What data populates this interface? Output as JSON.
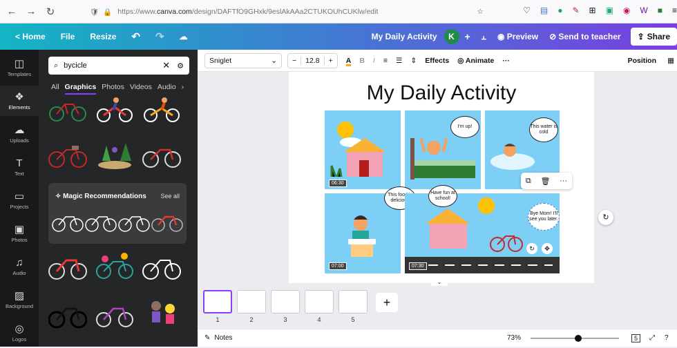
{
  "browser": {
    "url_prefix": "https://www.",
    "url_domain": "canva.com",
    "url_rest": "/design/DAFTfO9GHxk/9eslAkAAa2CTUKOUhCUKlw/edit"
  },
  "topbar": {
    "home": "< Home",
    "file": "File",
    "resize": "Resize",
    "title": "My Daily Activity",
    "avatar": "K",
    "preview": "Preview",
    "send": "Send to teacher",
    "share": "Share"
  },
  "rail": [
    {
      "icon": "templates-icon",
      "label": "Templates"
    },
    {
      "icon": "elements-icon",
      "label": "Elements"
    },
    {
      "icon": "uploads-icon",
      "label": "Uploads"
    },
    {
      "icon": "text-icon",
      "label": "Text"
    },
    {
      "icon": "projects-icon",
      "label": "Projects"
    },
    {
      "icon": "photos-icon",
      "label": "Photos"
    },
    {
      "icon": "audio-icon",
      "label": "Audio"
    },
    {
      "icon": "background-icon",
      "label": "Background"
    },
    {
      "icon": "logos-icon",
      "label": "Logos"
    }
  ],
  "search": {
    "value": "bycicle"
  },
  "tabs": [
    "All",
    "Graphics",
    "Photos",
    "Videos",
    "Audio"
  ],
  "magic": {
    "title": "Magic Recommendations",
    "see_all": "See all"
  },
  "toolbar": {
    "font": "Sniglet",
    "size": "12.8",
    "effects": "Effects",
    "animate": "Animate",
    "position": "Position"
  },
  "design": {
    "title": "My Daily Activity",
    "bubbles": [
      "I'm up!",
      "This water is cold",
      "This food is delicious",
      "Have fun at school!",
      "Bye Mom! I'll see you later."
    ],
    "times": [
      "06:30",
      "07:00",
      "07:30"
    ]
  },
  "pages": [
    "1",
    "2",
    "3",
    "4",
    "5"
  ],
  "status": {
    "notes": "Notes",
    "zoom": "73%",
    "page_count": "5"
  },
  "colors": {
    "accent": "#8b3dff",
    "sky": "#7dcff5"
  }
}
